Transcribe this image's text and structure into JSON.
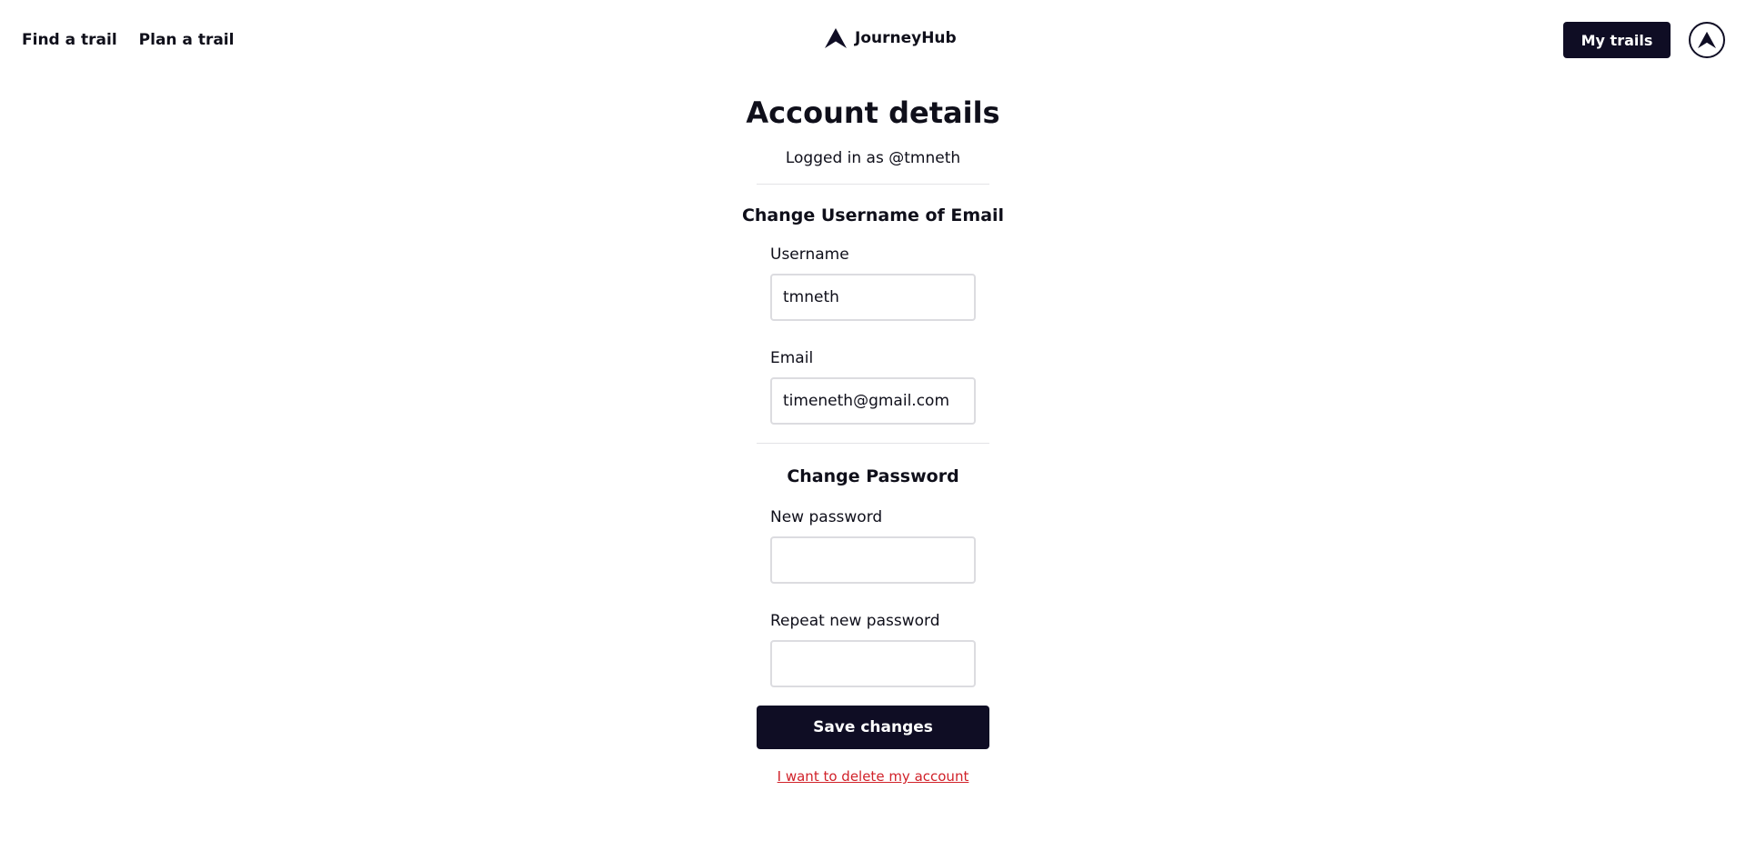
{
  "header": {
    "nav": [
      {
        "label": "Find a trail"
      },
      {
        "label": "Plan a trail"
      }
    ],
    "brand": {
      "name": "JourneyHub",
      "logo_icon": "mountain-logo-icon"
    },
    "my_trails_label": "My trails",
    "avatar_icon": "mountain-logo-icon"
  },
  "account": {
    "title": "Account details",
    "logged_in_text": "Logged in as @tmneth",
    "profile_section_title": "Change Username of Email",
    "username_label": "Username",
    "username_value": "tmneth",
    "email_label": "Email",
    "email_value": "timeneth@gmail.com",
    "password_section_title": "Change Password",
    "new_password_label": "New password",
    "new_password_value": "",
    "repeat_password_label": "Repeat new password",
    "repeat_password_value": "",
    "save_label": "Save changes",
    "delete_link_label": "I want to delete my account"
  },
  "colors": {
    "primary": "#0f0d24",
    "danger": "#d1222a",
    "border": "#dcdce0"
  }
}
